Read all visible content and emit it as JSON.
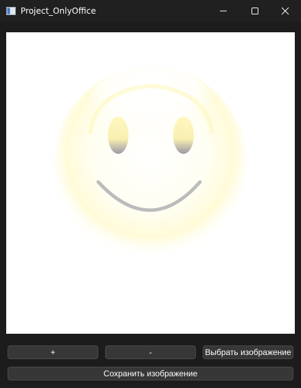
{
  "window": {
    "title": "Project_OnlyOffice",
    "controls": {
      "minimize_icon": "minimize-icon",
      "maximize_icon": "maximize-icon",
      "close_icon": "close-icon"
    }
  },
  "image_view": {
    "content_icon": "smiley-face-image"
  },
  "buttons": {
    "zoom_in_label": "+",
    "zoom_out_label": "-",
    "choose_image_label": "Выбрать изображение",
    "save_image_label": "Сохранить изображение"
  },
  "colors": {
    "window_bg": "#1c1c1c",
    "button_bg": "#373737",
    "button_border": "#4a4a4a",
    "canvas_bg": "#ffffff",
    "smiley_yellow": "#fffbd0",
    "smile_stroke": "#bcbcbc"
  }
}
